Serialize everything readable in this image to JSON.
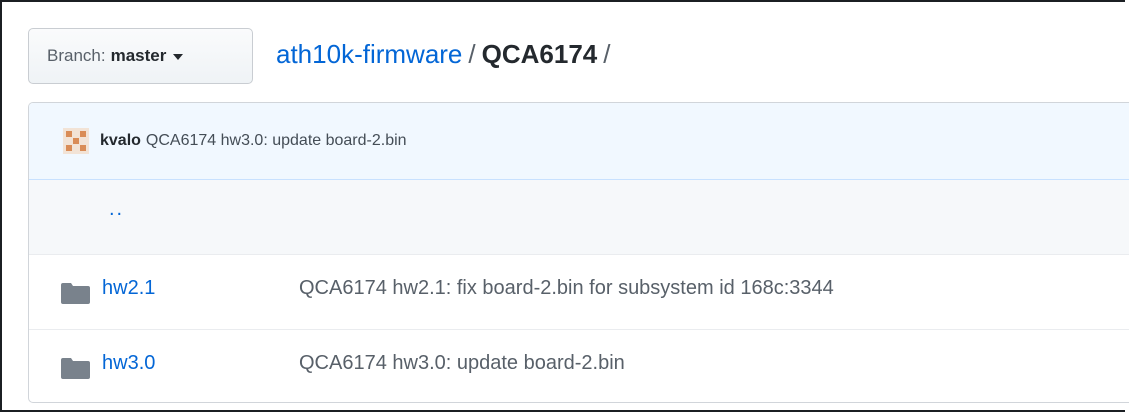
{
  "branch": {
    "label": "Branch:",
    "value": "master"
  },
  "breadcrumb": {
    "repo": "ath10k-firmware",
    "separator": "/",
    "current": "QCA6174",
    "trailing": "/"
  },
  "latest_commit": {
    "author": "kvalo",
    "message": "QCA6174 hw3.0: update board-2.bin"
  },
  "parent_dir": {
    "label": ".."
  },
  "files": [
    {
      "icon": "folder-icon",
      "name": "hw2.1",
      "message": "QCA6174 hw2.1: fix board-2.bin for subsystem id 168c:3344"
    },
    {
      "icon": "folder-icon",
      "name": "hw3.0",
      "message": "QCA6174 hw3.0: update board-2.bin"
    }
  ],
  "colors": {
    "link": "#0366d6",
    "commit_bar_bg": "#f1f8ff",
    "folder": "#79828c"
  }
}
